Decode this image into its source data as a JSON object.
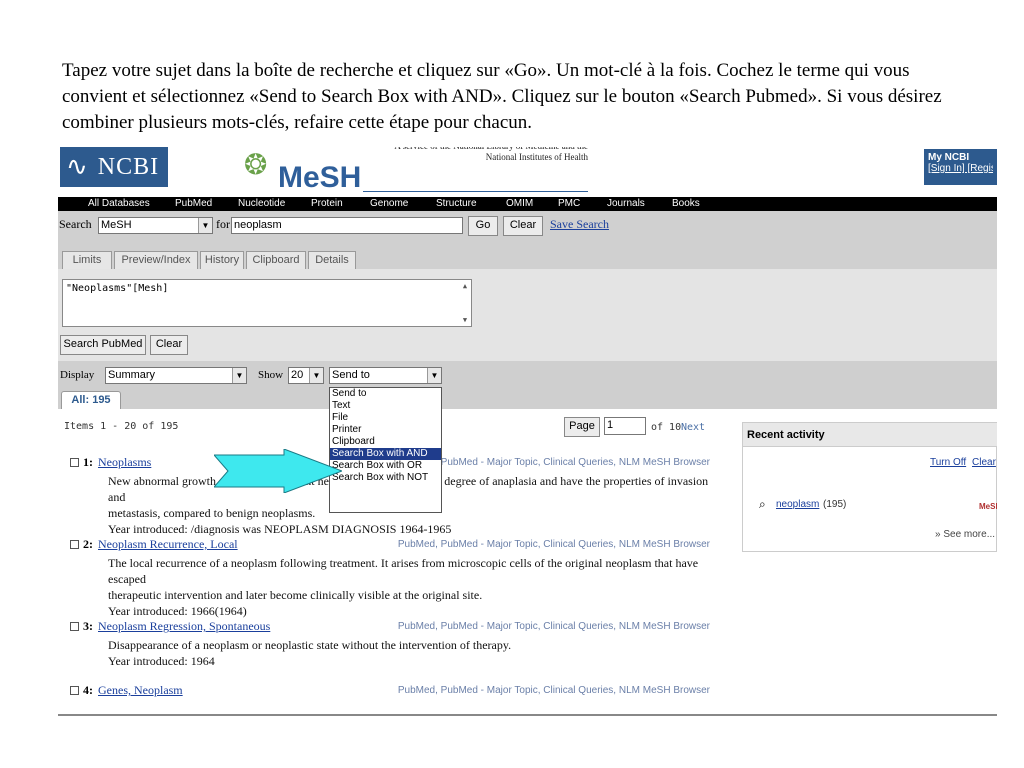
{
  "instructions": "Tapez votre sujet dans la boîte de recherche et cliquez sur «Go». Un mot-clé à la fois. Cochez le terme qui vous convient et sélectionnez «Send to Search Box with AND». Cliquez sur le bouton «Search Pubmed». Si vous désirez combiner plusieurs mots-clés, refaire cette étape pour chacun.",
  "header": {
    "ncbi_logo": "NCBI",
    "mesh_logo": "MeSH",
    "tagline": "A service of the National Library of Medicine and the National Institutes of Health",
    "myncbi_title": "My NCBI",
    "myncbi_links": "[Sign In] [Register]"
  },
  "nav": [
    "All Databases",
    "PubMed",
    "Nucleotide",
    "Protein",
    "Genome",
    "Structure",
    "OMIM",
    "PMC",
    "Journals",
    "Books"
  ],
  "search": {
    "label": "Search",
    "database": "MeSH",
    "for_label": "for",
    "query": "neoplasm",
    "go_label": "Go",
    "clear_label": "Clear",
    "save_search": "Save Search"
  },
  "tabs": [
    "Limits",
    "Preview/Index",
    "History",
    "Clipboard",
    "Details"
  ],
  "query_box": {
    "text": "\"Neoplasms\"[Mesh]",
    "search_pubmed": "Search PubMed",
    "clear": "Clear"
  },
  "display": {
    "label": "Display",
    "format": "Summary",
    "show_label": "Show",
    "show_count": "20",
    "send_to": "Send to",
    "all_tab": "All: 195"
  },
  "dropdown_options": [
    "Send to",
    "Text",
    "File",
    "Printer",
    "Clipboard",
    "Search Box with AND",
    "Search Box with OR",
    "Search Box with NOT"
  ],
  "dropdown_selected": "Search Box with AND",
  "pager": {
    "items_info": "Items 1 - 20 of 195",
    "page_label": "Page",
    "page_value": "1",
    "of_label": "of 10",
    "next_label": "Next"
  },
  "results": [
    {
      "num": "1:",
      "title": "Neoplasms",
      "links": "PubMed, PubMed - Major Topic, Clinical Queries, NLM MeSH Browser",
      "desc1": "New abnormal growth of tissue. Malignant neoplasms show a greater degree of anaplasia and have the properties of invasion and",
      "desc2": "metastasis, compared to benign neoplasms.",
      "desc3": "Year introduced: /diagnosis was NEOPLASM DIAGNOSIS 1964-1965"
    },
    {
      "num": "2:",
      "title": "Neoplasm Recurrence, Local",
      "links": "PubMed, PubMed - Major Topic, Clinical Queries, NLM MeSH Browser",
      "desc1": "The local recurrence of a neoplasm following treatment. It arises from microscopic cells of the original neoplasm that have escaped",
      "desc2": "therapeutic intervention and later become clinically visible at the original site.",
      "desc3": "Year introduced: 1966(1964)"
    },
    {
      "num": "3:",
      "title": "Neoplasm Regression, Spontaneous",
      "links": "PubMed, PubMed - Major Topic, Clinical Queries, NLM MeSH Browser",
      "desc1": "Disappearance of a neoplasm or neoplastic state without the intervention of therapy.",
      "desc2": "Year introduced: 1964",
      "desc3": ""
    },
    {
      "num": "4:",
      "title": "Genes, Neoplasm",
      "links": "PubMed, PubMed - Major Topic, Clinical Queries, NLM MeSH Browser",
      "desc1": "",
      "desc2": "",
      "desc3": ""
    }
  ],
  "recent": {
    "title": "Recent activity",
    "turn_off": "Turn Off",
    "clear": "Clear",
    "query_link": "neoplasm",
    "query_count": "(195)",
    "db_badge": "MeSH",
    "see_more": "» See more..."
  },
  "colors": {
    "ncbi_blue": "#2d5a8e",
    "link_blue": "#1a3f9c",
    "nav_black": "#000000",
    "arrow_cyan": "#3ee8ee",
    "selected_option": "#1f3c8c"
  }
}
